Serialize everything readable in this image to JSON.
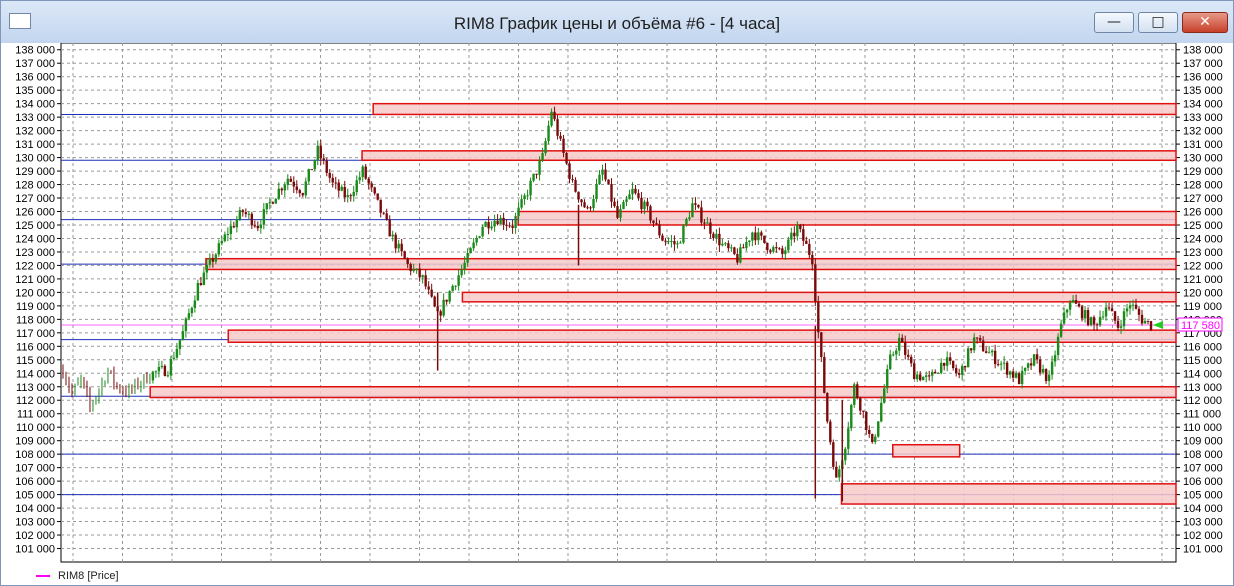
{
  "window": {
    "title": "RIM8 График цены и объёма #6 - [4 часа]",
    "buttons": {
      "minimize": "—",
      "maximize": "□",
      "close": "✕"
    }
  },
  "legend": {
    "label": "RIM8 [Price]",
    "color": "#ff00ff"
  },
  "chart_data": {
    "type": "candlestick",
    "title": "RIM8 График цены и объёма #6 - [4 часа]",
    "series_name": "RIM8 [Price]",
    "ylim": [
      100000,
      138500
    ],
    "y_ticks": [
      "101 000",
      "102 000",
      "103 000",
      "104 000",
      "105 000",
      "106 000",
      "107 000",
      "108 000",
      "109 000",
      "110 000",
      "111 000",
      "112 000",
      "113 000",
      "114 000",
      "115 000",
      "116 000",
      "117 000",
      "118 000",
      "119 000",
      "120 000",
      "121 000",
      "122 000",
      "123 000",
      "124 000",
      "125 000",
      "126 000",
      "127 000",
      "128 000",
      "129 000",
      "130 000",
      "131 000",
      "132 000",
      "133 000",
      "134 000",
      "135 000",
      "136 000",
      "137 000",
      "138 000"
    ],
    "grid": true,
    "last_price": 117580,
    "last_price_label": "117 580",
    "colors": {
      "up": "#1a8a1a",
      "down": "#7a0a0a",
      "zone_fill": "#f7c9c9",
      "zone_stroke": "#e01010",
      "level_line": "#1c2fb8",
      "price_line": "#ff00ff"
    },
    "levels": [
      133200,
      129800,
      125400,
      122100,
      116500,
      112300,
      108000,
      105000
    ],
    "zones": [
      {
        "from_index": 0.28,
        "low": 133200,
        "high": 134000
      },
      {
        "from_index": 0.27,
        "low": 129800,
        "high": 130500
      },
      {
        "from_index": 0.41,
        "low": 125000,
        "high": 126000
      },
      {
        "from_index": 0.13,
        "low": 121700,
        "high": 122500
      },
      {
        "from_index": 0.36,
        "low": 119300,
        "high": 120000
      },
      {
        "from_index": 0.15,
        "low": 116300,
        "high": 117200
      },
      {
        "from_index": 0.08,
        "low": 112200,
        "high": 113000
      },
      {
        "from_index": 0.7,
        "low": 104300,
        "high": 105800
      },
      {
        "from_index": 0.746,
        "to_index": 0.806,
        "low": 107800,
        "high": 108700
      }
    ],
    "path": [
      [
        0,
        114200
      ],
      [
        3,
        112500
      ],
      [
        6,
        113500
      ],
      [
        9,
        111500
      ],
      [
        12,
        112800
      ],
      [
        15,
        114200
      ],
      [
        18,
        113000
      ],
      [
        22,
        112600
      ],
      [
        26,
        113400
      ],
      [
        30,
        114000
      ],
      [
        35,
        114300
      ],
      [
        40,
        117000
      ],
      [
        45,
        120500
      ],
      [
        50,
        122500
      ],
      [
        55,
        124500
      ],
      [
        60,
        126000
      ],
      [
        65,
        125000
      ],
      [
        70,
        127000
      ],
      [
        75,
        128500
      ],
      [
        80,
        127500
      ],
      [
        85,
        130500
      ],
      [
        90,
        128000
      ],
      [
        95,
        127000
      ],
      [
        100,
        129000
      ],
      [
        105,
        126500
      ],
      [
        110,
        124000
      ],
      [
        115,
        122000
      ],
      [
        120,
        121000
      ],
      [
        125,
        118200
      ],
      [
        130,
        120500
      ],
      [
        135,
        122500
      ],
      [
        140,
        125000
      ],
      [
        145,
        125500
      ],
      [
        150,
        125000
      ],
      [
        155,
        127500
      ],
      [
        160,
        130000
      ],
      [
        163,
        133500
      ],
      [
        166,
        131000
      ],
      [
        170,
        128000
      ],
      [
        175,
        126000
      ],
      [
        180,
        129000
      ],
      [
        185,
        125500
      ],
      [
        190,
        127500
      ],
      [
        195,
        126000
      ],
      [
        200,
        124000
      ],
      [
        205,
        123500
      ],
      [
        210,
        126500
      ],
      [
        215,
        125000
      ],
      [
        220,
        123500
      ],
      [
        225,
        122500
      ],
      [
        230,
        124500
      ],
      [
        235,
        123500
      ],
      [
        240,
        122800
      ],
      [
        245,
        124800
      ],
      [
        250,
        122500
      ],
      [
        252,
        117000
      ],
      [
        255,
        110500
      ],
      [
        258,
        106000
      ],
      [
        261,
        108800
      ],
      [
        264,
        113000
      ],
      [
        267,
        111000
      ],
      [
        270,
        108500
      ],
      [
        273,
        111800
      ],
      [
        276,
        115000
      ],
      [
        279,
        116500
      ],
      [
        284,
        114000
      ],
      [
        289,
        113500
      ],
      [
        294,
        115000
      ],
      [
        299,
        113800
      ],
      [
        304,
        116500
      ],
      [
        309,
        115500
      ],
      [
        314,
        114500
      ],
      [
        319,
        113500
      ],
      [
        324,
        115000
      ],
      [
        329,
        113500
      ],
      [
        333,
        117500
      ],
      [
        336,
        119500
      ],
      [
        340,
        118500
      ],
      [
        344,
        117500
      ],
      [
        348,
        119000
      ],
      [
        352,
        117500
      ],
      [
        356,
        119200
      ],
      [
        360,
        118000
      ],
      [
        363,
        117580
      ]
    ]
  }
}
